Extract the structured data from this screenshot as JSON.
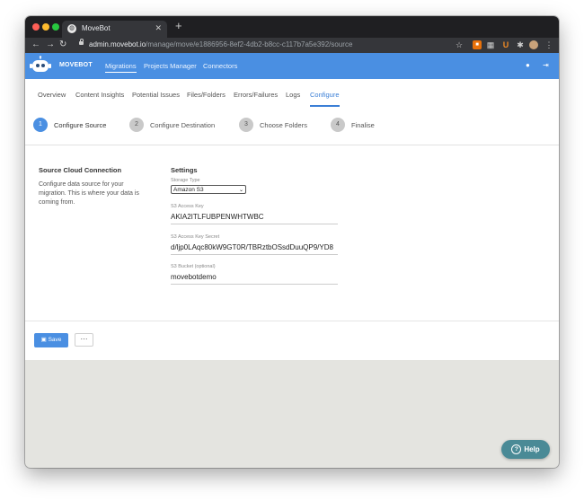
{
  "browser": {
    "tab_title": "MoveBot",
    "tab_icon": "globe-icon",
    "url_host": "admin.movebot.io",
    "url_path": "/manage/move/e1886956-8ef2-4db2-b8cc-c117b7a5e392/source"
  },
  "colors": {
    "accent": "#4a8fe2",
    "header_bg": "#4a8fe2",
    "help_bg": "#4a8a96",
    "page_bg": "#e4e4e0"
  },
  "header": {
    "brand": "MOVEBOT",
    "nav": [
      "Migrations",
      "Projects Manager",
      "Connectors"
    ]
  },
  "subnav": {
    "tabs": [
      "Overview",
      "Content Insights",
      "Potential Issues",
      "Files/Folders",
      "Errors/Failures",
      "Logs",
      "Configure"
    ]
  },
  "steps": [
    {
      "num": "1",
      "label": "Configure Source"
    },
    {
      "num": "2",
      "label": "Configure Destination"
    },
    {
      "num": "3",
      "label": "Choose Folders"
    },
    {
      "num": "4",
      "label": "Finalise"
    }
  ],
  "section": {
    "title": "Source Cloud Connection",
    "description": "Configure data source for your migration. This is where your data is coming from."
  },
  "settings": {
    "title": "Settings",
    "storage_type_label": "Storage Type",
    "storage_type_value": "Amazon S3",
    "access_key_label": "S3 Access Key",
    "access_key_value": "AKIA2ITLFUBPENWHTWBC",
    "secret_label": "S3 Access Key Secret",
    "secret_value": "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",
    "bucket_label": "S3 Bucket (optional)",
    "bucket_value": "movebotdemo"
  },
  "footer": {
    "save_label": "Save",
    "more_label": "···"
  },
  "help": {
    "label": "Help"
  }
}
